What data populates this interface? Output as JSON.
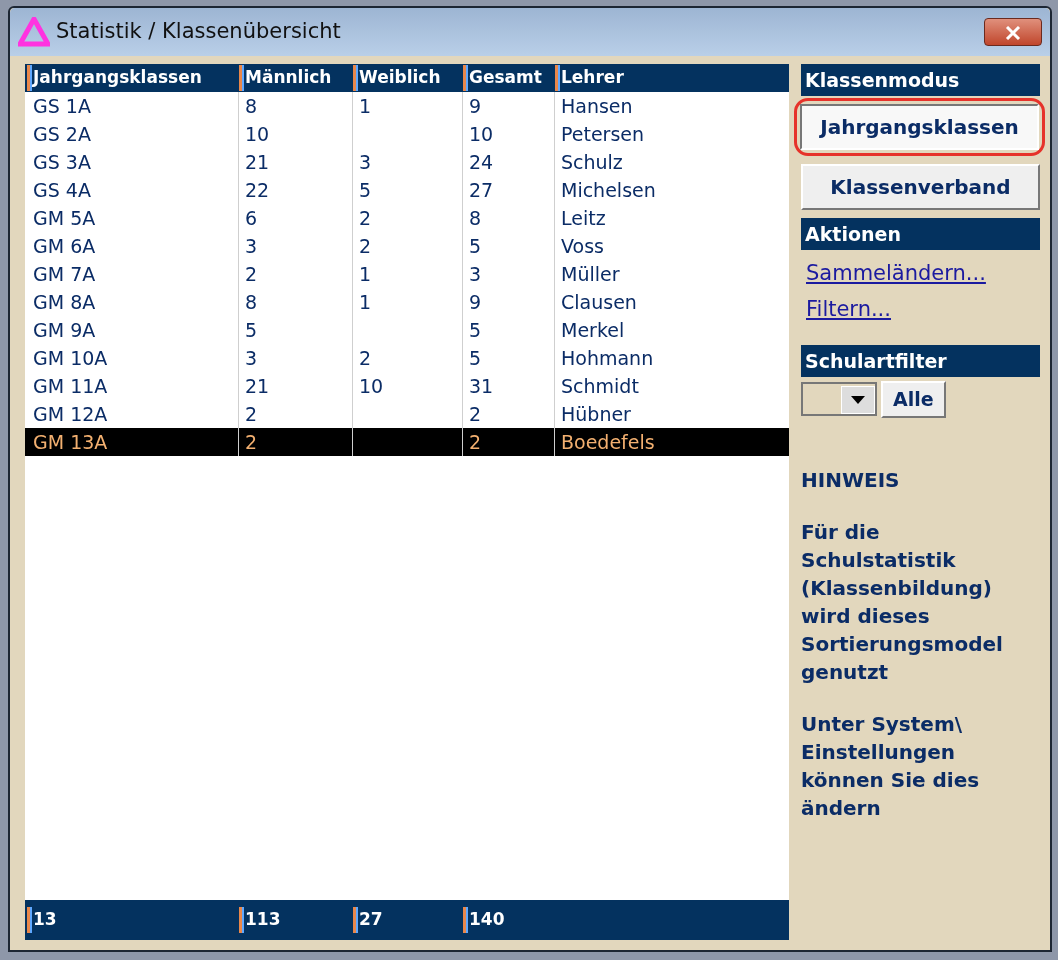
{
  "window": {
    "title": "Statistik / Klassenübersicht"
  },
  "table": {
    "columns": [
      "Jahrgangsklassen",
      "Männlich",
      "Weiblich",
      "Gesamt",
      "Lehrer"
    ],
    "rows": [
      {
        "cells": [
          "GS 1A",
          "8",
          "1",
          "9",
          "Hansen"
        ],
        "selected": false
      },
      {
        "cells": [
          "GS 2A",
          "10",
          "",
          "10",
          "Petersen"
        ],
        "selected": false
      },
      {
        "cells": [
          "GS 3A",
          "21",
          "3",
          "24",
          "Schulz"
        ],
        "selected": false
      },
      {
        "cells": [
          "GS 4A",
          "22",
          "5",
          "27",
          "Michelsen"
        ],
        "selected": false
      },
      {
        "cells": [
          "GM 5A",
          "6",
          "2",
          "8",
          "Leitz"
        ],
        "selected": false
      },
      {
        "cells": [
          "GM 6A",
          "3",
          "2",
          "5",
          "Voss"
        ],
        "selected": false
      },
      {
        "cells": [
          "GM 7A",
          "2",
          "1",
          "3",
          "Müller"
        ],
        "selected": false
      },
      {
        "cells": [
          "GM 8A",
          "8",
          "1",
          "9",
          "Clausen"
        ],
        "selected": false
      },
      {
        "cells": [
          "GM 9A",
          "5",
          "",
          "5",
          "Merkel"
        ],
        "selected": false
      },
      {
        "cells": [
          "GM 10A",
          "3",
          "2",
          "5",
          "Hohmann"
        ],
        "selected": false
      },
      {
        "cells": [
          "GM 11A",
          "21",
          "10",
          "31",
          "Schmidt"
        ],
        "selected": false
      },
      {
        "cells": [
          "GM 12A",
          "2",
          "",
          "2",
          "Hübner"
        ],
        "selected": false
      },
      {
        "cells": [
          "GM 13A",
          "2",
          "",
          "2",
          "Boedefels"
        ],
        "selected": true
      }
    ],
    "totals": [
      "13",
      "113",
      "27",
      "140"
    ]
  },
  "sidebar": {
    "mode_heading": "Klassenmodus",
    "mode_buttons": [
      {
        "label": "Jahrgangsklassen",
        "selected": true,
        "highlighted": true
      },
      {
        "label": "Klassenverband",
        "selected": false,
        "highlighted": false
      }
    ],
    "actions_heading": "Aktionen",
    "actions": [
      "Sammeländern...",
      "Filtern..."
    ],
    "filter_heading": "Schulartfilter",
    "filter_button": "Alle",
    "note_title": "HINWEIS",
    "note_paragraphs": [
      "Für die Schulstatistik (Klassenbildung) wird dieses Sortierungsmodel genutzt",
      "Unter System\\ Einstellungen können Sie dies ändern"
    ]
  }
}
